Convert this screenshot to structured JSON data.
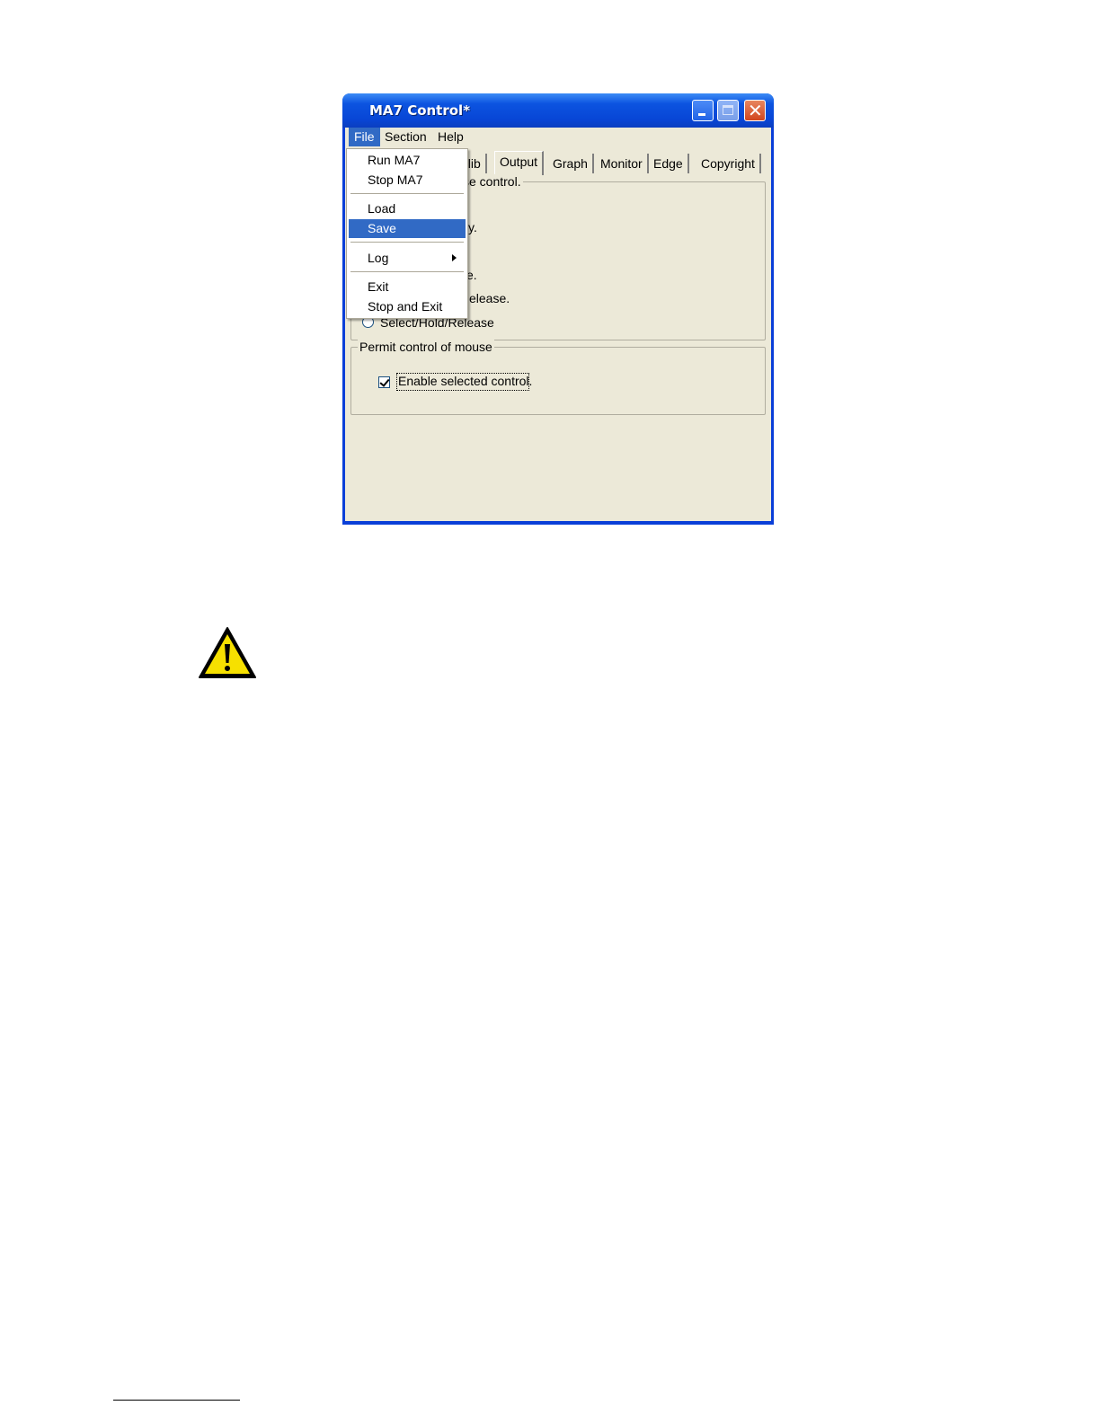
{
  "window": {
    "title": "MA7 Control*"
  },
  "menubar": {
    "items": [
      "File",
      "Section",
      "Help"
    ]
  },
  "tabs": {
    "items": [
      "alib",
      "Output",
      "Graph",
      "Monitor",
      "Edge",
      "Copyright"
    ],
    "selected": "Output"
  },
  "output_group": {
    "label_fragment": "se control.",
    "options_fragments": [
      "y.",
      "e.",
      "elease.",
      "Select/Hold/Release"
    ]
  },
  "mouse_group": {
    "label": "Permit control of mouse",
    "checkbox_label": "Enable selected control.",
    "checkbox_checked": true
  },
  "file_menu": {
    "items": [
      "Run MA7",
      "Stop MA7",
      "Load",
      "Save",
      "Log",
      "Exit",
      "Stop and Exit"
    ],
    "highlighted": "Save"
  },
  "icons": {
    "warning": "warning-triangle-icon"
  }
}
